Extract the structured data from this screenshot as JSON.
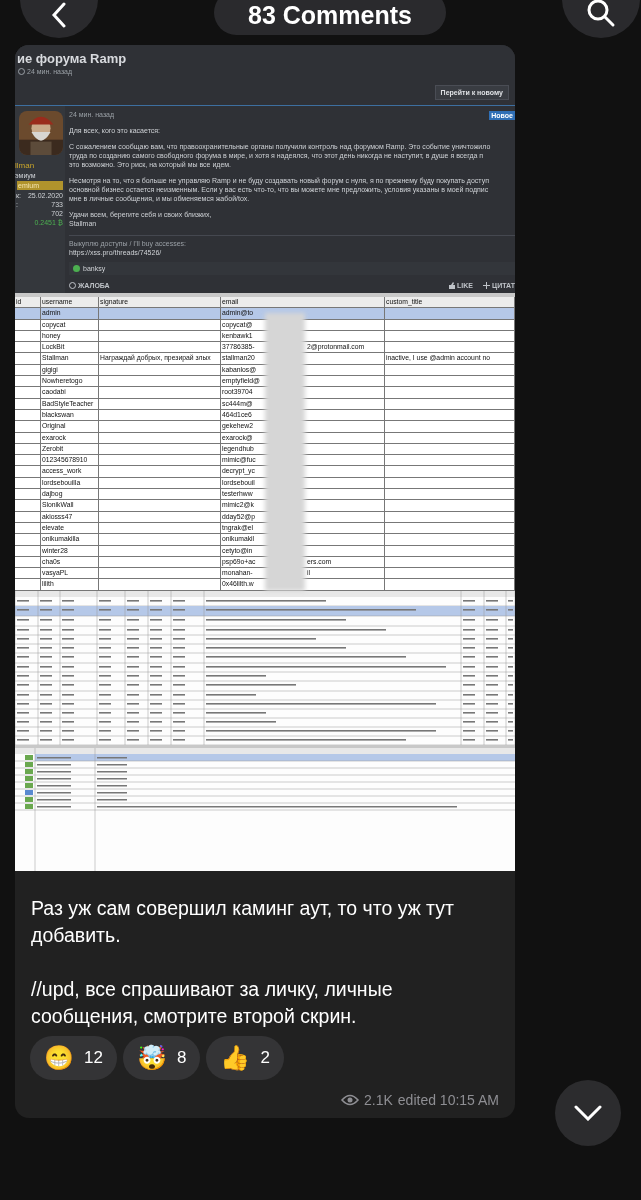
{
  "header": {
    "title": "83 Comments"
  },
  "forum": {
    "title": "ие форума Ramp",
    "time": "24 мин. назад",
    "jump_button": "Перейти к новому",
    "author": {
      "name": "llman",
      "rank": "эмиум",
      "badge": "emium",
      "stats": [
        {
          "label": "к:",
          "value": "25.02.2020"
        },
        {
          "label": ":",
          "value": "733"
        },
        {
          "value": "702"
        }
      ],
      "balance": "0.2451 ₿"
    },
    "post": {
      "time": "24 мин. назад",
      "badge": "Новое",
      "paragraphs": [
        [
          "Для всех, кого это касается:"
        ],
        [
          "С сожалением сообщаю вам, что правоохранительные органы получили контроль над форумом Ramp. Это событие уничтожило",
          "труда по созданию самого свободного форума в мире, и хотя я надеялся, что этот день никогда не наступит, в душе я всегда п",
          "это возможно. Это риск, на который мы все идем."
        ],
        [
          "Несмотря на то, что я больше не управляю Ramp и не буду создавать новый форум с нуля, я по прежнему буду покупать доступ",
          "основной бизнес остается неизменным. Если у вас есть что-то, что вы можете мне предложить, условия указаны в моей подпис",
          "мне в личные сообщения, и мы обменяемся жабой/tox."
        ],
        [
          "Удачи всем, берегите себя и своих близких,",
          "Stallman"
        ]
      ],
      "signature": "Выкуплю доступы / I'll buy accesses:",
      "signature_link": "https://xss.pro/threads/74526/",
      "reaction_user": "banksy",
      "report": "ЖАЛОБА",
      "like": "LIKE",
      "quote": "ЦИТАТ"
    }
  },
  "users_table": {
    "columns": [
      "id",
      "username",
      "signature",
      "email",
      "custom_title"
    ],
    "rows": [
      {
        "username": "admin",
        "signature": "",
        "email": "admin@to",
        "email_end": "",
        "custom_title": "",
        "selected": true
      },
      {
        "username": "copycat",
        "signature": "",
        "email": "copycat@",
        "email_end": "",
        "custom_title": "",
        "selected": false
      },
      {
        "username": "honey",
        "signature": "",
        "email": "kenbawk1",
        "email_end": "",
        "custom_title": "",
        "selected": false
      },
      {
        "username": "LockBit",
        "signature": "",
        "email": "37786385-",
        "email_end": "2@protonmail.com",
        "custom_title": "",
        "selected": false
      },
      {
        "username": "Stallman",
        "signature": "Награждай добрых, презирай злых",
        "email": "stallman20",
        "email_end": "",
        "custom_title": "inactive, I use @admin account no",
        "selected": false
      },
      {
        "username": "gigigi",
        "signature": "",
        "email": "kabanlos@",
        "email_end": "",
        "custom_title": "",
        "selected": false
      },
      {
        "username": "Nowheretogo",
        "signature": "",
        "email": "emptyfield@",
        "email_end": "",
        "custom_title": "",
        "selected": false
      },
      {
        "username": "caodabi",
        "signature": "",
        "email": "root39704",
        "email_end": "",
        "custom_title": "",
        "selected": false
      },
      {
        "username": "BadStyleTeacher",
        "signature": "",
        "email": "sc444m@",
        "email_end": "",
        "custom_title": "",
        "selected": false
      },
      {
        "username": "blackswan",
        "signature": "",
        "email": "464d1ce6",
        "email_end": "",
        "custom_title": "",
        "selected": false
      },
      {
        "username": "Original",
        "signature": "",
        "email": "gekehew2",
        "email_end": "",
        "custom_title": "",
        "selected": false
      },
      {
        "username": "exarock",
        "signature": "",
        "email": "exarock@",
        "email_end": "",
        "custom_title": "",
        "selected": false
      },
      {
        "username": "Zerobit",
        "signature": "",
        "email": "legendhub",
        "email_end": "",
        "custom_title": "",
        "selected": false
      },
      {
        "username": "012345678910",
        "signature": "",
        "email": "mimic@fuc",
        "email_end": "",
        "custom_title": "",
        "selected": false
      },
      {
        "username": "access_work",
        "signature": "",
        "email": "decrypt_yc",
        "email_end": "",
        "custom_title": "",
        "selected": false
      },
      {
        "username": "lordsebouilla",
        "signature": "",
        "email": "lordsebouil",
        "email_end": "",
        "custom_title": "",
        "selected": false
      },
      {
        "username": "dajbog",
        "signature": "",
        "email": "testerhww",
        "email_end": "",
        "custom_title": "",
        "selected": false
      },
      {
        "username": "SlonikWall",
        "signature": "",
        "email": "mimic2@k",
        "email_end": "",
        "custom_title": "",
        "selected": false
      },
      {
        "username": "akiosss47",
        "signature": "",
        "email": "dday52@p",
        "email_end": "",
        "custom_title": "",
        "selected": false
      },
      {
        "username": "elevate",
        "signature": "",
        "email": "tngrak@el",
        "email_end": "",
        "custom_title": "",
        "selected": false
      },
      {
        "username": "onikumakilla",
        "signature": "",
        "email": "onikumakil",
        "email_end": "",
        "custom_title": "",
        "selected": false
      },
      {
        "username": "winter28",
        "signature": "",
        "email": "cetyto@in",
        "email_end": "",
        "custom_title": "",
        "selected": false
      },
      {
        "username": "cha0s",
        "signature": "",
        "email": "psp69o+ac",
        "email_end": "ers.com",
        "custom_title": "",
        "selected": false
      },
      {
        "username": "vasyaPL",
        "signature": "",
        "email": "monahan-",
        "email_end": "il",
        "custom_title": "",
        "selected": false
      },
      {
        "username": "lilith",
        "signature": "",
        "email": "0x46lilth.w",
        "email_end": "",
        "custom_title": "",
        "selected": false
      }
    ]
  },
  "spreadsheet": {
    "kind": "picture"
  },
  "caption": [
    "Раз уж сам совершил каминг аут, то что уж тут добавить.",
    "//upd, все спрашивают за личку, личные сообщения, смотрите второй скрин."
  ],
  "reactions": [
    {
      "emoji": "😁",
      "count": "12"
    },
    {
      "emoji": "🤯",
      "count": "8"
    },
    {
      "emoji": "👍",
      "count": "2"
    }
  ],
  "meta": {
    "views": "2.1K",
    "edited": "edited 10:15 AM"
  }
}
